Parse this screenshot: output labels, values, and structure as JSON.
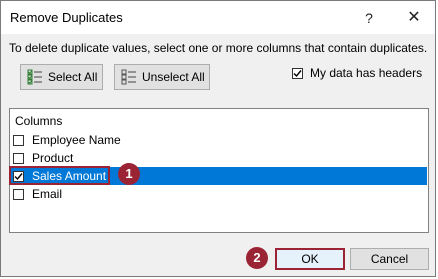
{
  "dialog": {
    "title": "Remove Duplicates",
    "help_icon": "?",
    "close_icon": "✕",
    "instruction": "To delete duplicate values, select one or more columns that contain duplicates."
  },
  "toolbar": {
    "select_all_label": "Select All",
    "unselect_all_label": "Unselect All",
    "select_all_icon": "checklist-icon",
    "unselect_all_icon": "unchecklist-icon"
  },
  "headers_option": {
    "label": "My data has headers",
    "checked": true
  },
  "columns": {
    "label": "Columns",
    "items": [
      {
        "label": "Employee Name",
        "checked": false
      },
      {
        "label": "Product",
        "checked": false
      },
      {
        "label": "Sales Amount",
        "checked": true,
        "selected": true
      },
      {
        "label": "Email",
        "checked": false
      }
    ]
  },
  "annotations": {
    "badge1": "1",
    "badge2": "2",
    "color": "#9b2434"
  },
  "footer": {
    "ok_label": "OK",
    "cancel_label": "Cancel"
  },
  "colors": {
    "selection": "#0078d7",
    "dialog_bg": "#f0f0f0"
  }
}
